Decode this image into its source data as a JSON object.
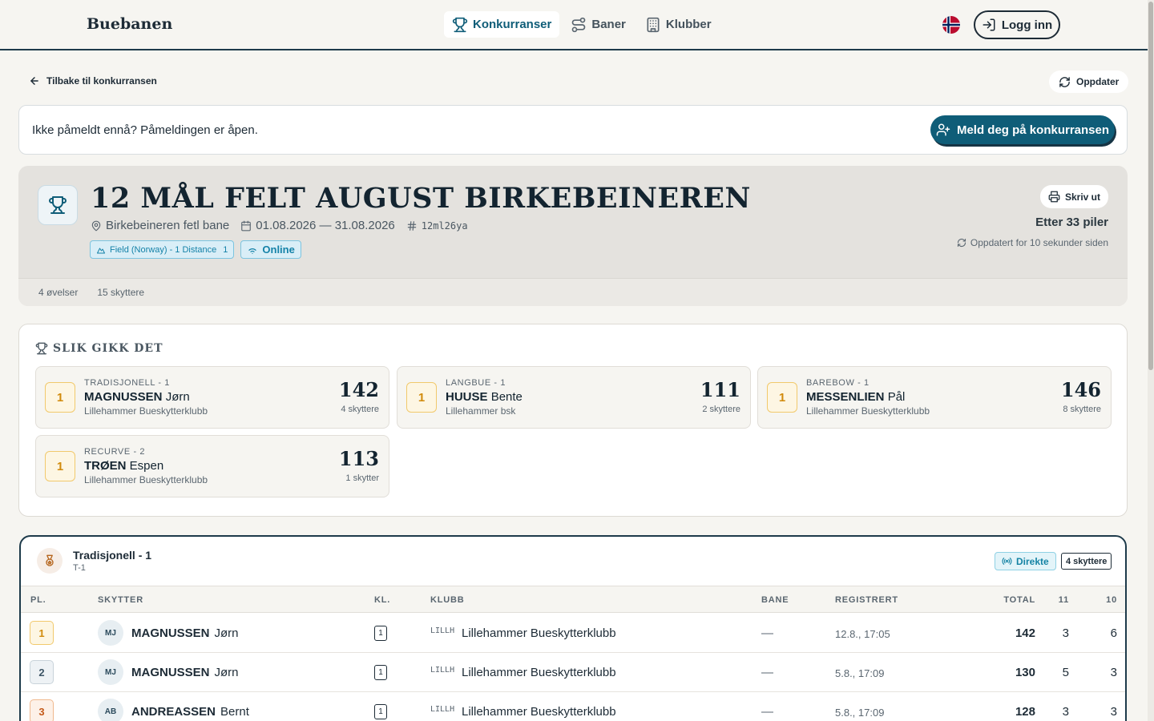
{
  "header": {
    "logo": "Buebanen",
    "nav": [
      {
        "label": "Konkurranser",
        "icon": "trophy-icon",
        "active": true
      },
      {
        "label": "Baner",
        "icon": "route-icon",
        "active": false
      },
      {
        "label": "Klubber",
        "icon": "building-icon",
        "active": false
      }
    ],
    "language_flag": "norway-flag-icon",
    "login_label": "Logg inn"
  },
  "toolbar": {
    "back_label": "Tilbake til konkurransen",
    "refresh_label": "Oppdater"
  },
  "registration": {
    "text": "Ikke påmeldt ennå? Påmeldingen er åpen.",
    "button_label": "Meld deg på konkurransen"
  },
  "competition": {
    "title": "12 MÅL FELT AUGUST BIRKEBEINEREN",
    "venue": "Birkebeineren fetl bane",
    "dates": "01.08.2026 — 31.08.2026",
    "code": "12ml26ya",
    "tags": [
      {
        "label": "Field (Norway) - 1 Distance",
        "count": "1"
      },
      {
        "label": "Online"
      }
    ],
    "print_label": "Skriv ut",
    "progress": "Etter 33 piler",
    "updated": "Oppdatert for 10 sekunder siden",
    "stats": [
      "4 øvelser",
      "15 skyttere"
    ]
  },
  "summary": {
    "heading": "SLIK GIKK DET",
    "cards": [
      {
        "rank": "1",
        "class": "TRADISJONELL - 1",
        "last": "MAGNUSSEN",
        "first": "Jørn",
        "club": "Lillehammer Bueskytterklubb",
        "score": "142",
        "count": "4 skyttere"
      },
      {
        "rank": "1",
        "class": "LANGBUE - 1",
        "last": "HUUSE",
        "first": "Bente",
        "club": "Lillehammer bsk",
        "score": "111",
        "count": "2 skyttere"
      },
      {
        "rank": "1",
        "class": "BAREBOW - 1",
        "last": "MESSENLIEN",
        "first": "Pål",
        "club": "Lillehammer Bueskytterklubb",
        "score": "146",
        "count": "8 skyttere"
      },
      {
        "rank": "1",
        "class": "RECURVE - 2",
        "last": "TRØEN",
        "first": "Espen",
        "club": "Lillehammer Bueskytterklubb",
        "score": "113",
        "count": "1 skytter"
      }
    ]
  },
  "class_table": {
    "title": "Tradisjonell - 1",
    "subtitle": "T-1",
    "live_label": "Direkte",
    "count_label": "4 skyttere",
    "columns": [
      "PL.",
      "SKYTTER",
      "KL.",
      "KLUBB",
      "BANE",
      "REGISTRERT",
      "TOTAL",
      "11",
      "10"
    ],
    "rows": [
      {
        "place": "1",
        "initials": "MJ",
        "last": "MAGNUSSEN",
        "first": "Jørn",
        "kl": "1",
        "abbr": "LILLH",
        "club": "Lillehammer Bueskytterklubb",
        "bane": "—",
        "registered": "12.8., 17:05",
        "total": "142",
        "c11": "3",
        "c10": "6"
      },
      {
        "place": "2",
        "initials": "MJ",
        "last": "MAGNUSSEN",
        "first": "Jørn",
        "kl": "1",
        "abbr": "LILLH",
        "club": "Lillehammer Bueskytterklubb",
        "bane": "—",
        "registered": "5.8., 17:09",
        "total": "130",
        "c11": "5",
        "c10": "3"
      },
      {
        "place": "3",
        "initials": "AB",
        "last": "ANDREASSEN",
        "first": "Bernt",
        "kl": "1",
        "abbr": "LILLH",
        "club": "Lillehammer Bueskytterklubb",
        "bane": "—",
        "registered": "5.8., 17:09",
        "total": "128",
        "c11": "3",
        "c10": "3"
      }
    ]
  }
}
